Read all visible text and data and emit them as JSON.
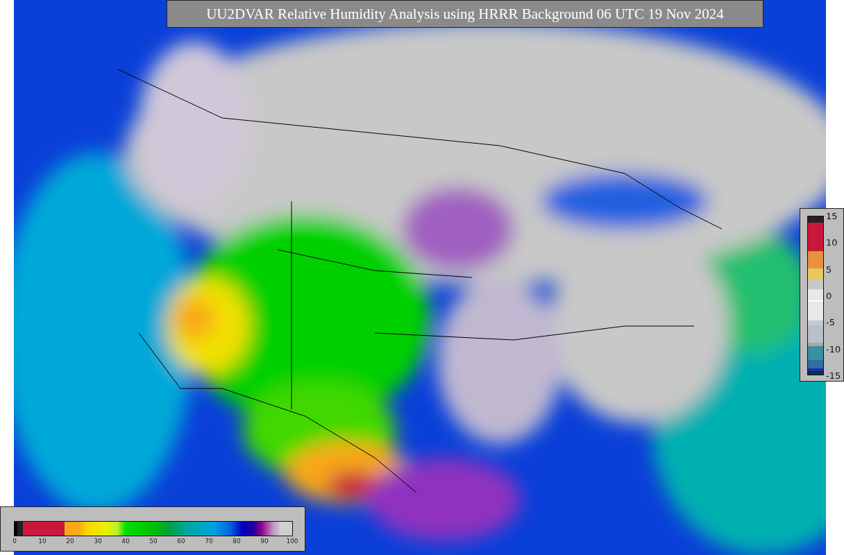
{
  "title": "UU2DVAR Relative Humidity Analysis using HRRR Background 06 UTC 19 Nov 2024",
  "colorbar_right": {
    "ticks": [
      "15",
      "10",
      "5",
      "0",
      "-5",
      "-10",
      "-15"
    ]
  },
  "colorbar_bottom": {
    "ticks": [
      "0",
      "10",
      "20",
      "30",
      "40",
      "50",
      "60",
      "70",
      "80",
      "90",
      "100"
    ]
  }
}
